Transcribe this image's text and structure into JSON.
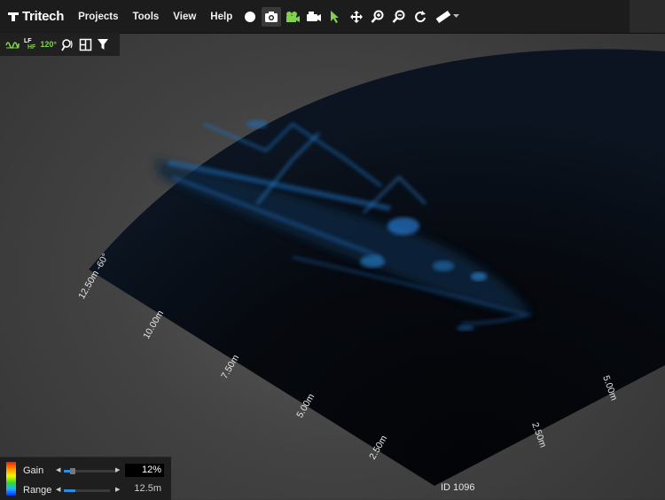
{
  "app": {
    "logo_text": "Tritech"
  },
  "menu": {
    "items": [
      "Projects",
      "Tools",
      "View",
      "Help"
    ]
  },
  "subtoolbar": {
    "frequency_top": "LF",
    "frequency_bottom": "HF",
    "aperture": "120°"
  },
  "sonar": {
    "range_labels_left": [
      "12.50m -60°",
      "10.00m",
      "7.50m",
      "5.00m",
      "2.50m"
    ],
    "range_labels_right": [
      "5.00m",
      "2.50m"
    ],
    "image_id": "ID 1096"
  },
  "controls": {
    "gain": {
      "label": "Gain",
      "value": "12%",
      "level": 0.12
    },
    "range": {
      "label": "Range",
      "value": "12.5m",
      "level": 0.25
    }
  },
  "colors": {
    "accent_green": "#7fd24a",
    "sonar_blue": "#2a8fe0",
    "menubar": "#1c1c1c"
  }
}
